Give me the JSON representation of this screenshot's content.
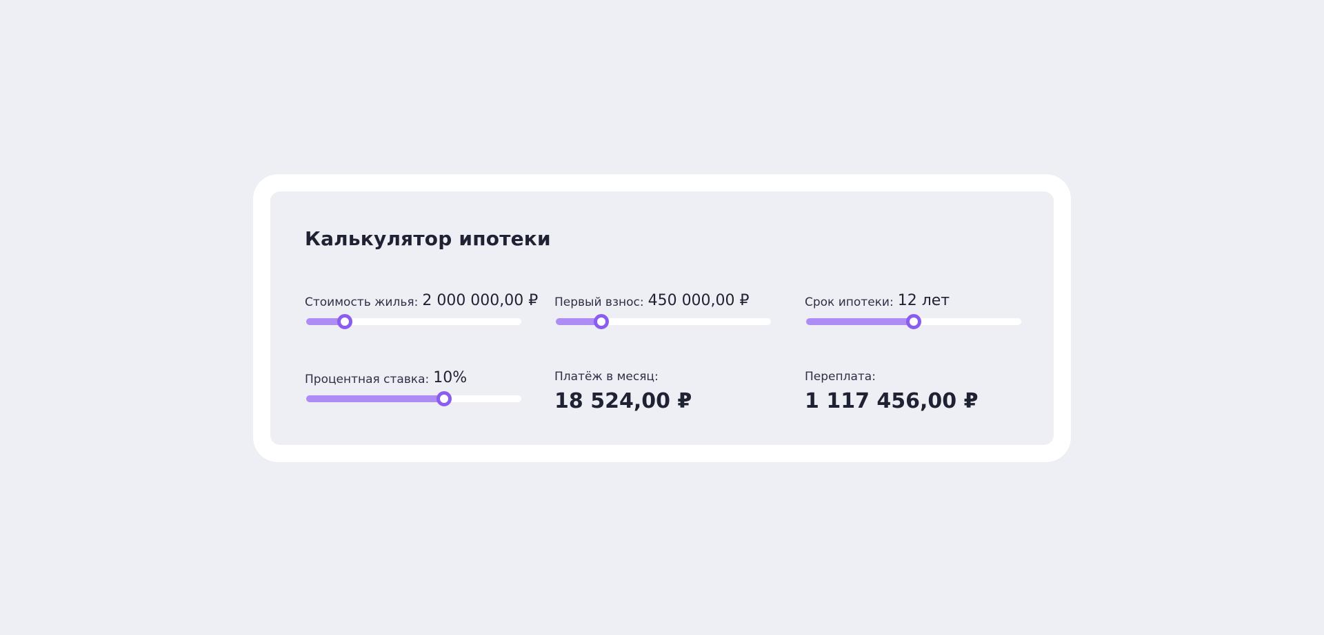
{
  "calculator": {
    "title": "Калькулятор ипотеки",
    "accent_color": "#8b5cf0",
    "fill_color": "#ae8cf5",
    "sliders": {
      "price": {
        "label": "Стоимость жилья:",
        "value": "2 000 000,00 ₽",
        "fraction": 0.18
      },
      "down_payment": {
        "label": "Первый взнос:",
        "value": "450 000,00 ₽",
        "fraction": 0.21
      },
      "term": {
        "label": "Срок ипотеки:",
        "value": "12 лет",
        "fraction": 0.5
      },
      "rate": {
        "label": "Процентная ставка:",
        "value": "10%",
        "fraction": 0.64
      }
    },
    "results": {
      "monthly_payment": {
        "label": "Платёж в месяц:",
        "value": "18 524,00 ₽"
      },
      "overpayment": {
        "label": "Переплата:",
        "value": "1 117 456,00 ₽"
      }
    }
  }
}
